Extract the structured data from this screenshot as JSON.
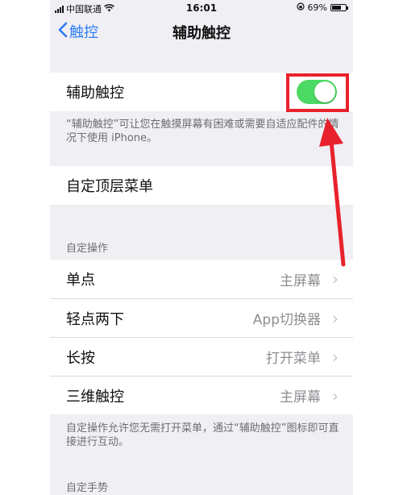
{
  "status_bar": {
    "carrier": "中国联通",
    "time": "16:01",
    "battery_percent": "69%",
    "battery_level": 0.69
  },
  "nav": {
    "back_label": "触控",
    "title": "辅助触控"
  },
  "assistive_touch": {
    "label": "辅助触控",
    "enabled": true,
    "footer": "“辅助触控”可让您在触摸屏幕有困难或需要自适应配件的情况下使用 iPhone。"
  },
  "customize_menu": {
    "label": "自定顶层菜单"
  },
  "custom_actions": {
    "header": "自定操作",
    "rows": [
      {
        "label": "单点",
        "value": "主屏幕"
      },
      {
        "label": "轻点两下",
        "value": "App切换器"
      },
      {
        "label": "长按",
        "value": "打开菜单"
      },
      {
        "label": "三维触控",
        "value": "主屏幕"
      }
    ],
    "footer": "自定操作允许您无需打开菜单，通过“辅助触控”图标即可直接进行互动。"
  },
  "custom_gestures": {
    "header": "自定手势"
  },
  "colors": {
    "accent": "#2f7cf6",
    "toggle_on": "#4cd964",
    "annotation_red": "#e8222c"
  }
}
